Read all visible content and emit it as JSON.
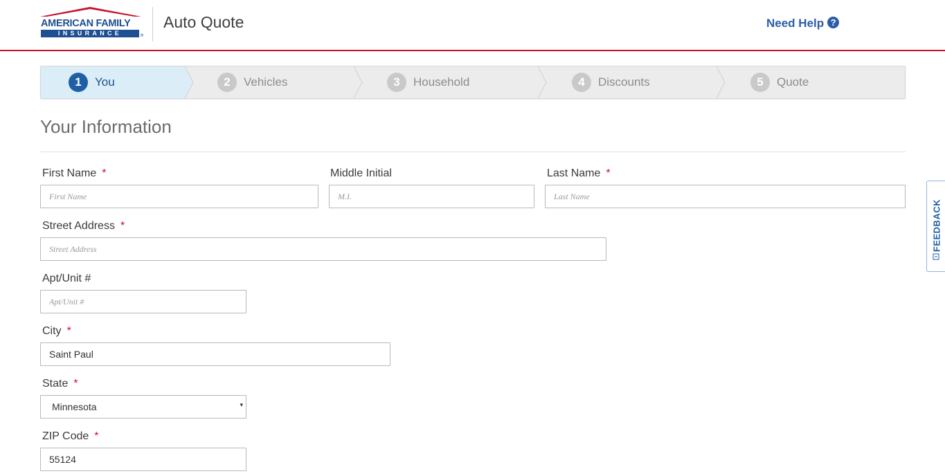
{
  "header": {
    "logo_line1": "AMERICAN FAMILY",
    "logo_line2": "INSURANCE",
    "logo_reg": "®",
    "app_title": "Auto Quote",
    "need_help": "Need Help",
    "help_icon_glyph": "?"
  },
  "steps": [
    {
      "num": "1",
      "label": "You",
      "active": true
    },
    {
      "num": "2",
      "label": "Vehicles",
      "active": false
    },
    {
      "num": "3",
      "label": "Household",
      "active": false
    },
    {
      "num": "4",
      "label": "Discounts",
      "active": false
    },
    {
      "num": "5",
      "label": "Quote",
      "active": false
    }
  ],
  "section": {
    "title": "Your Information"
  },
  "form": {
    "required_mark": "*",
    "first_name": {
      "label": "First Name",
      "placeholder": "First Name",
      "value": ""
    },
    "middle_initial": {
      "label": "Middle Initial",
      "placeholder": "M.I.",
      "value": ""
    },
    "last_name": {
      "label": "Last Name",
      "placeholder": "Last Name",
      "value": ""
    },
    "street_address": {
      "label": "Street Address",
      "placeholder": "Street Address",
      "value": ""
    },
    "apt_unit": {
      "label": "Apt/Unit #",
      "placeholder": "Apt/Unit #",
      "value": ""
    },
    "city": {
      "label": "City",
      "value": "Saint Paul"
    },
    "state": {
      "label": "State",
      "value": "Minnesota",
      "caret": "▾"
    },
    "zip": {
      "label": "ZIP Code",
      "value": "55124"
    }
  },
  "feedback": {
    "label": "FEEDBACK"
  },
  "colors": {
    "brand_red": "#c8102e",
    "brand_blue": "#1d4f91",
    "link_blue": "#2a5da8"
  }
}
